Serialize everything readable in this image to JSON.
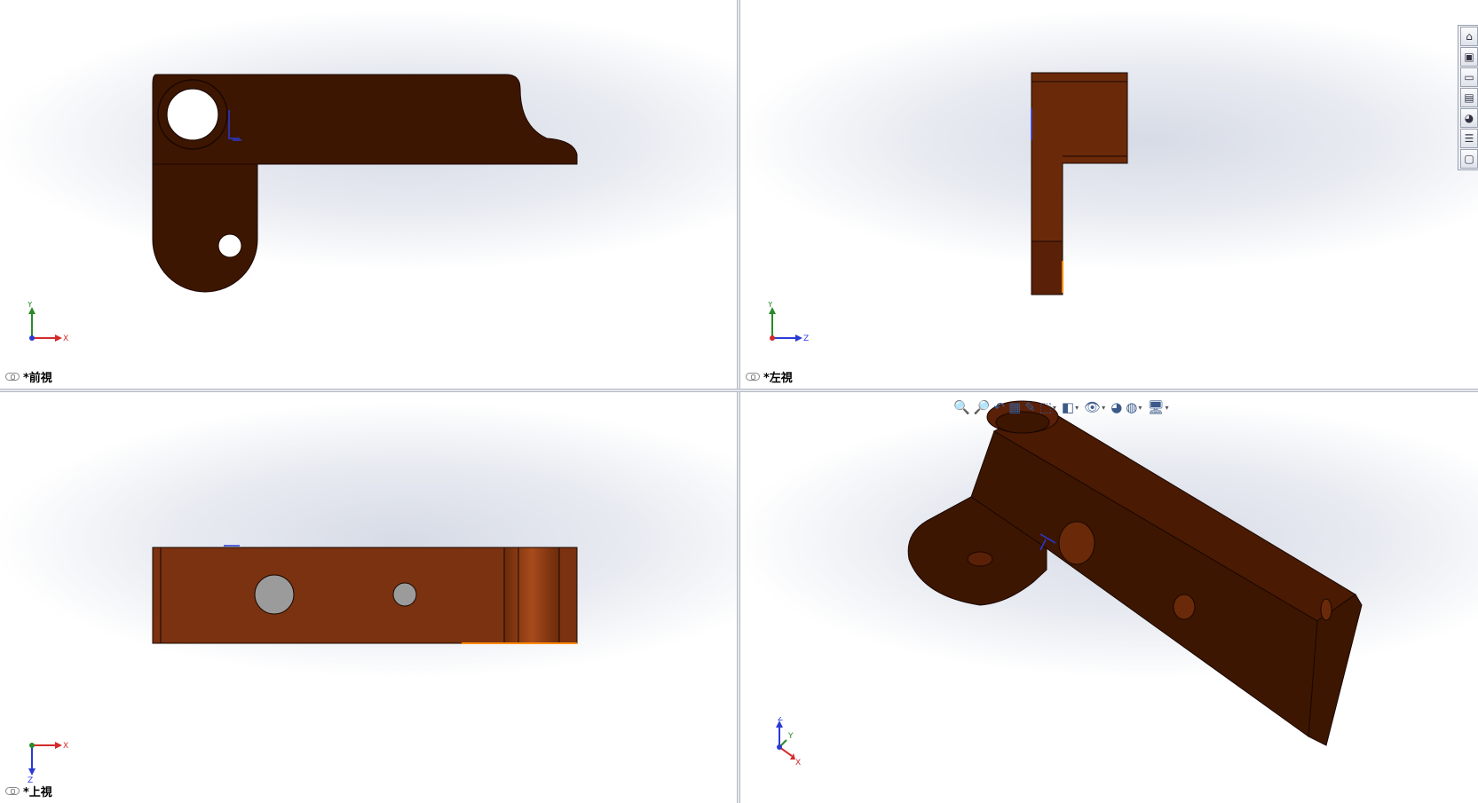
{
  "viewports": {
    "front": {
      "label": "*前視",
      "axes": {
        "vertical": "Y",
        "horizontal": "X"
      }
    },
    "left": {
      "label": "*左視",
      "axes": {
        "vertical": "Y",
        "horizontal": "Z"
      }
    },
    "top": {
      "label": "*上視",
      "axes": {
        "vertical": "Z",
        "horizontal": "X"
      }
    },
    "iso": {
      "label": "",
      "axes": {
        "a": "Z",
        "b": "Y",
        "c": "X"
      }
    }
  },
  "colors": {
    "part_dark": "#3d1601",
    "part_mid": "#6a2a0a",
    "part_light": "#7b3210",
    "edge": "#1a0700",
    "axis_x": "#d42a2a",
    "axis_y": "#2a8a2a",
    "axis_z": "#2a3ad4",
    "highlight": "#ff8a00"
  },
  "side_toolbar": {
    "items": [
      {
        "icon": "home-view-icon"
      },
      {
        "icon": "3d-box-icon"
      },
      {
        "icon": "folder-icon"
      },
      {
        "icon": "appearance-manager-icon"
      },
      {
        "icon": "scene-sphere-icon"
      },
      {
        "icon": "property-list-icon"
      },
      {
        "icon": "monitor-comment-icon"
      }
    ]
  },
  "hud_toolbar": {
    "items": [
      {
        "icon": "zoom-to-fit-icon",
        "glyph": "🔍"
      },
      {
        "icon": "zoom-to-area-icon",
        "glyph": "🔎"
      },
      {
        "icon": "previous-view-icon",
        "glyph": "↶"
      },
      {
        "icon": "section-view-icon",
        "glyph": "▦"
      },
      {
        "icon": "dynamic-annotation-icon",
        "glyph": "✎"
      },
      {
        "icon": "view-orientation-icon",
        "glyph": "⬚",
        "dropdown": true
      },
      {
        "icon": "display-style-icon",
        "glyph": "◧",
        "dropdown": true
      },
      {
        "icon": "hide-show-items-icon",
        "glyph": "👁",
        "dropdown": true
      },
      {
        "icon": "edit-appearance-icon",
        "glyph": "◕"
      },
      {
        "icon": "apply-scene-icon",
        "glyph": "◍",
        "dropdown": true
      },
      {
        "icon": "view-settings-icon",
        "glyph": "🖥",
        "dropdown": true
      }
    ]
  }
}
